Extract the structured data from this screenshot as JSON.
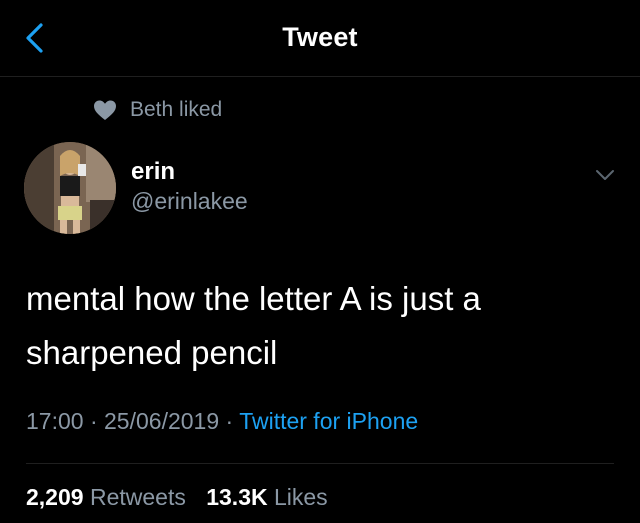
{
  "header": {
    "title": "Tweet",
    "back_icon": "chevron-left-icon"
  },
  "social_context": {
    "icon": "heart-icon",
    "text": "Beth liked"
  },
  "author": {
    "name": "erin",
    "handle": "@erinlakee"
  },
  "tweet": {
    "text": "mental how the letter A is just a sharpened pencil",
    "time": "17:00",
    "separator": "·",
    "date": "25/06/2019",
    "source": "Twitter for iPhone"
  },
  "stats": {
    "retweets_count": "2,209",
    "retweets_label": "Retweets",
    "likes_count": "13.3K",
    "likes_label": "Likes"
  },
  "colors": {
    "background": "#000000",
    "text": "#ffffff",
    "muted": "#8b98a5",
    "accent": "#1da1f2"
  }
}
